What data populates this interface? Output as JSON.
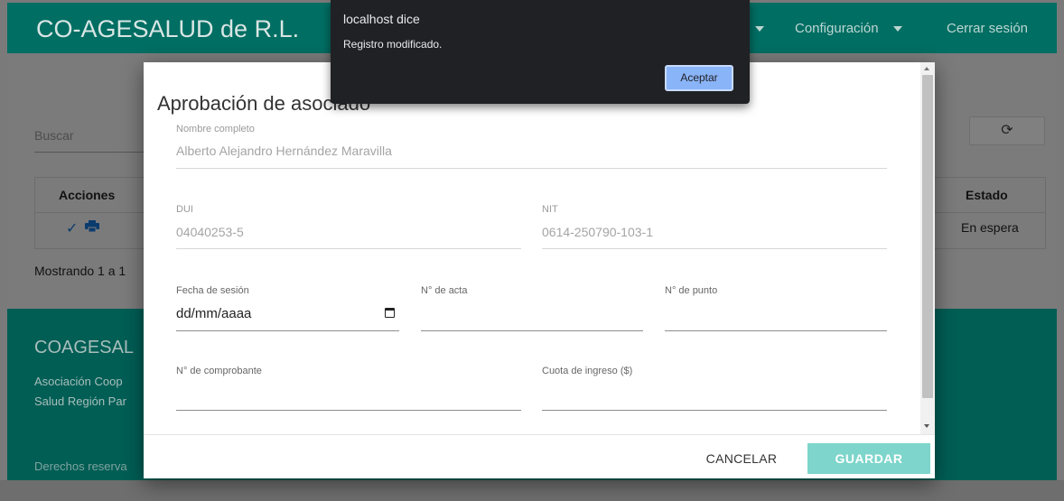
{
  "navbar": {
    "brand": "CO-AGESALUD de R.L.",
    "menu_config": "Configuración",
    "logout": "Cerrar sesión"
  },
  "main": {
    "search_label": "Buscar",
    "table_headers": {
      "actions": "Acciones",
      "status": "Estado"
    },
    "row": {
      "status": "En espera"
    },
    "showing": "Mostrando 1 a 1"
  },
  "footer": {
    "title": "COAGESAL",
    "line1": "Asociación Coop",
    "line2": "Salud Región Par",
    "rights": "Derechos reserva"
  },
  "modal": {
    "title": "Aprobación de asociado",
    "fields": {
      "nombre": {
        "label": "Nombre completo",
        "value": "Alberto Alejandro Hernández Maravilla"
      },
      "dui": {
        "label": "DUI",
        "value": "04040253-5"
      },
      "nit": {
        "label": "NIT",
        "value": "0614-250790-103-1"
      },
      "fecha": {
        "label": "Fecha de sesión",
        "placeholder": "dd/mm/aaaa"
      },
      "acta": {
        "label": "N° de acta"
      },
      "punto": {
        "label": "N° de punto"
      },
      "comprobante": {
        "label": "N° de comprobante"
      },
      "cuota": {
        "label": "Cuota de ingreso ($)"
      }
    },
    "cancel": "CANCELAR",
    "save": "GUARDAR"
  },
  "alert": {
    "title": "localhost dice",
    "message": "Registro modificado.",
    "ok": "Aceptar"
  },
  "colors": {
    "navbar": "#006e63",
    "save_button": "#7dd5cb",
    "alert_bg": "#202124",
    "alert_button": "#8ab4f8"
  }
}
